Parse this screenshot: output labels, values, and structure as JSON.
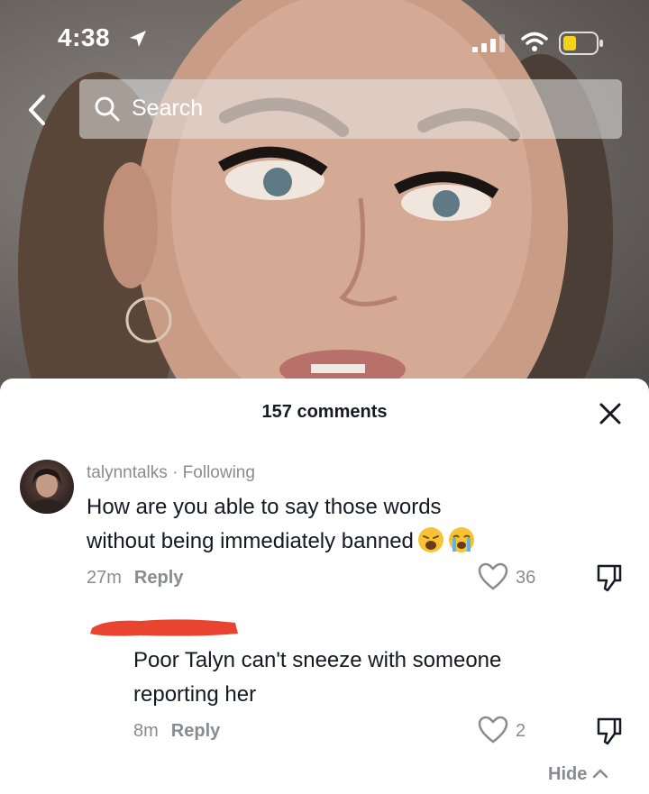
{
  "status_bar": {
    "time": "4:38"
  },
  "search": {
    "placeholder": "Search"
  },
  "comments": {
    "count_label": "157 comments",
    "items": [
      {
        "username": "talynntalks",
        "relation": "Following",
        "text_line1": "How are you able to say those words",
        "text_line2": "without being immediately banned",
        "emojis": [
          "weary-face-emoji",
          "loudly-crying-face-emoji"
        ],
        "age": "27m",
        "reply_label": "Reply",
        "likes": "36"
      },
      {
        "username_redacted": true,
        "text_line1": "Poor Talyn can't sneeze with someone",
        "text_line2": "reporting her",
        "age": "8m",
        "reply_label": "Reply",
        "likes": "2"
      }
    ],
    "hide_label": "Hide"
  },
  "colors": {
    "text_primary": "#161823",
    "text_secondary": "#8a8b91",
    "redaction": "#e8442f"
  }
}
